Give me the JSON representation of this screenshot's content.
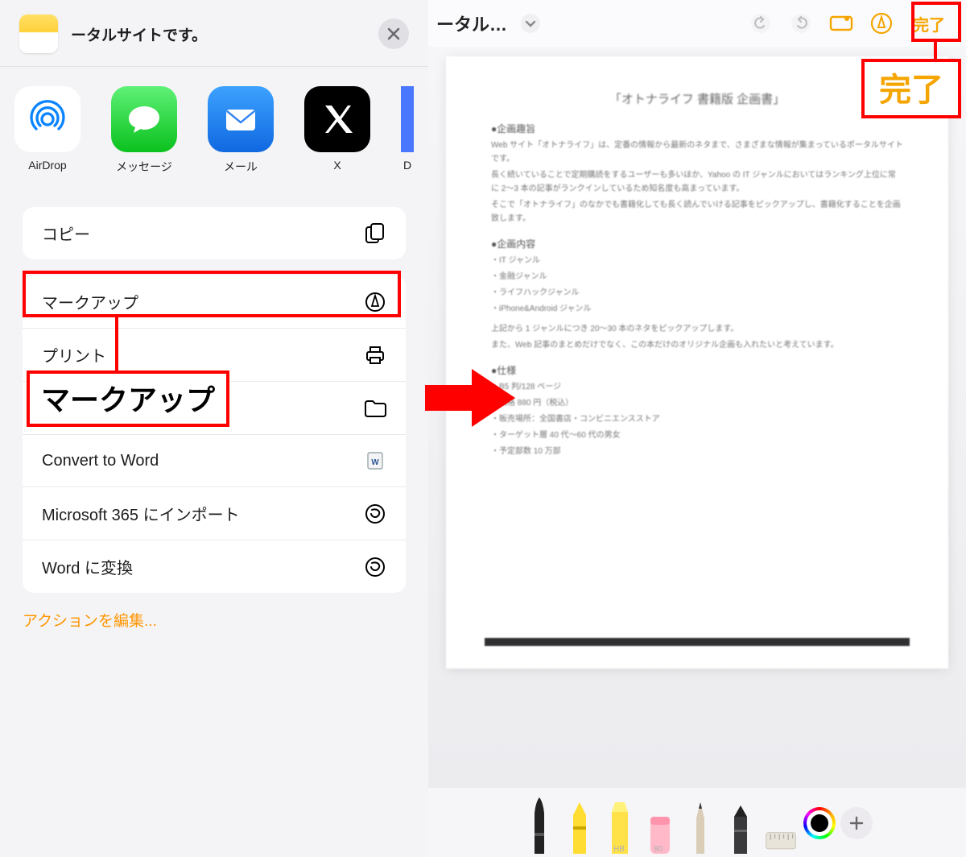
{
  "share": {
    "title": "ータルサイトです。",
    "targets": [
      {
        "key": "airdrop",
        "label": "AirDrop"
      },
      {
        "key": "messages",
        "label": "メッセージ"
      },
      {
        "key": "mail",
        "label": "メール"
      },
      {
        "key": "x",
        "label": "X"
      },
      {
        "key": "partial",
        "label": "D"
      }
    ],
    "actions_group1": [
      {
        "key": "copy",
        "label": "コピー"
      }
    ],
    "actions_group2": [
      {
        "key": "markup",
        "label": "マークアップ"
      },
      {
        "key": "print",
        "label": "プリント"
      },
      {
        "key": "save_to_files",
        "label": "\"ファイル\"に保存"
      },
      {
        "key": "convert_word",
        "label": "Convert to Word"
      },
      {
        "key": "ms365_import",
        "label": "Microsoft 365 にインポート"
      },
      {
        "key": "word_convert_jp",
        "label": "Word に変換"
      }
    ],
    "edit_actions": "アクションを編集...",
    "callout_markup": "マークアップ"
  },
  "markup": {
    "title": "ータル…",
    "done": "完了",
    "palette_labels": {
      "pencil": "HB",
      "crayon": "80"
    }
  },
  "document": {
    "title": "「オトナライフ 書籍版 企画書」",
    "h1": "●企画趣旨",
    "b1a": "Web サイト「オトナライフ」は、定番の情報から最新のネタまで、さまざまな情報が集まっているポータルサイトです。",
    "b1b": "長く続いていることで定期購読をするユーザーも多いほか、Yahoo の IT ジャンルにおいてはランキング上位に常に 2〜3 本の記事がランクインしているため知名度も高まっています。",
    "b1c": "そこで「オトナライフ」のなかでも書籍化しても長く読んでいける記事をピックアップし、書籍化することを企画致します。",
    "h2": "●企画内容",
    "b2a": "・IT ジャンル",
    "b2b": "・金融ジャンル",
    "b2c": "・ライフハックジャンル",
    "b2d": "・iPhone&Android ジャンル",
    "b2e": "上記から 1 ジャンルにつき 20〜30 本のネタをピックアップします。",
    "b2f": "また、Web 記事のまとめだけでなく、この本だけのオリジナル企画も入れたいと考えています。",
    "h3": "●仕様",
    "b3a": "・B5 判/128 ページ",
    "b3b": "・価格 880 円（税込）",
    "b3c": "・販売場所：全国書店・コンビニエンスストア",
    "b3d": "・ターゲット層 40 代〜60 代の男女",
    "b3e": "・予定部数 10 万部"
  },
  "callout_done": "完了"
}
